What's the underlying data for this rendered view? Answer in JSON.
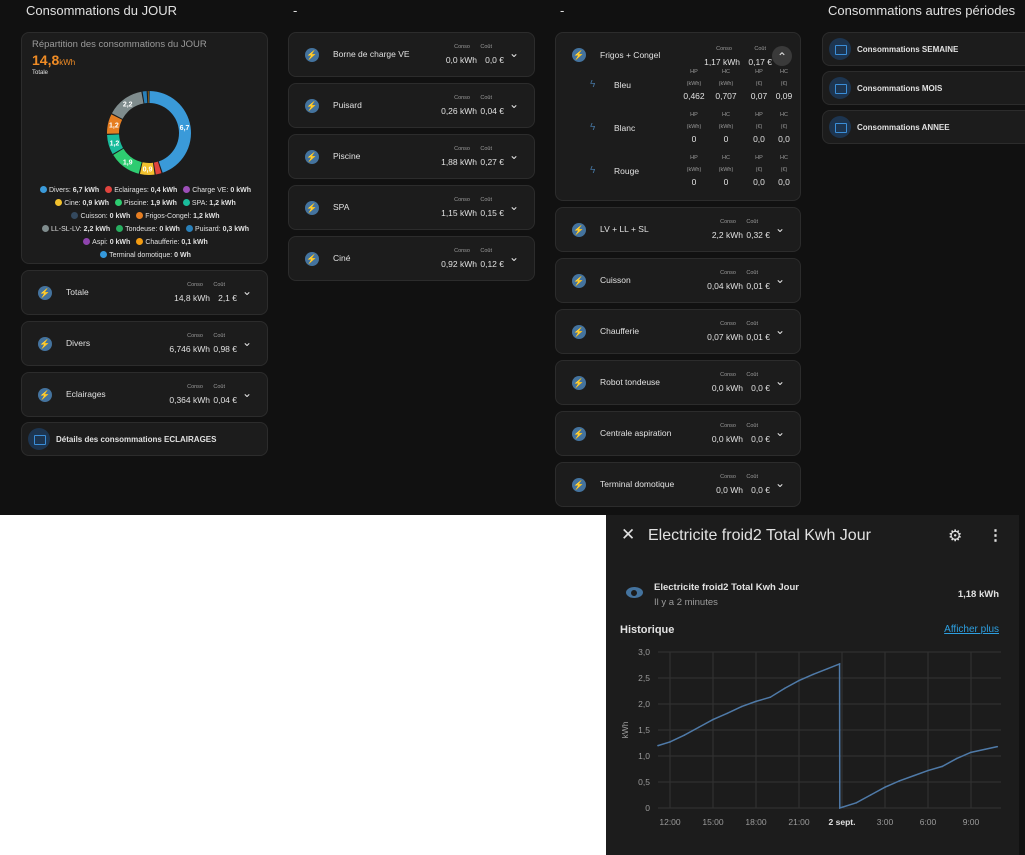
{
  "columns": [
    {
      "title": "Consommations du JOUR"
    },
    {
      "title": "-"
    },
    {
      "title": "-"
    },
    {
      "title": "Consommations autres périodes"
    }
  ],
  "donut_card": {
    "title": "Répartition des consommations du JOUR",
    "total_value": "14,8",
    "total_unit": "kWh",
    "total_label": "Totale"
  },
  "chart_data": [
    {
      "type": "pie",
      "variant": "donut",
      "unit": "kWh",
      "slices": [
        {
          "name": "Divers",
          "value": 6.7,
          "label": "6,7",
          "legend": "6,7 kWh",
          "color": "#3a9ad9"
        },
        {
          "name": "Eclairages",
          "value": 0.4,
          "label": "",
          "legend": "0,4 kWh",
          "color": "#e0443e"
        },
        {
          "name": "Charge VE",
          "value": 0,
          "label": "",
          "legend": "0 kWh",
          "color": "#9c4fb8"
        },
        {
          "name": "Cine",
          "value": 0.9,
          "label": "0,9",
          "legend": "0,9 kWh",
          "color": "#f2c12e"
        },
        {
          "name": "Piscine",
          "value": 1.9,
          "label": "1,9",
          "legend": "1,9 kWh",
          "color": "#2ecc71"
        },
        {
          "name": "SPA",
          "value": 1.2,
          "label": "1,2",
          "legend": "1,2 kWh",
          "color": "#1abc9c"
        },
        {
          "name": "Cuisson",
          "value": 0,
          "label": "",
          "legend": "0 kWh",
          "color": "#34495e"
        },
        {
          "name": "Frigos-Congel",
          "value": 1.2,
          "label": "1,2",
          "legend": "1,2 kWh",
          "color": "#e67e22"
        },
        {
          "name": "LL-SL-LV",
          "value": 2.2,
          "label": "2,2",
          "legend": "2,2 kWh",
          "color": "#7f8c8d"
        },
        {
          "name": "Tondeuse",
          "value": 0,
          "label": "",
          "legend": "0 kWh",
          "color": "#27ae60"
        },
        {
          "name": "Puisard",
          "value": 0.3,
          "label": "",
          "legend": "0,3 kWh",
          "color": "#2980b9"
        },
        {
          "name": "Aspi",
          "value": 0,
          "label": "",
          "legend": "0 kWh",
          "color": "#8e44ad"
        },
        {
          "name": "Chaufferie",
          "value": 0.1,
          "label": "",
          "legend": "0,1 kWh",
          "color": "#f39c12"
        },
        {
          "name": "Terminal domotique",
          "value": 0,
          "label": "",
          "legend": "0 Wh",
          "color": "#3498db"
        }
      ]
    },
    {
      "type": "line",
      "title": "Historique",
      "ylabel": "kWh",
      "ylim": [
        0,
        3
      ],
      "yticks": [
        "0",
        "0,5",
        "1,0",
        "1,5",
        "2,0",
        "2,5",
        "3,0"
      ],
      "xticks": [
        "12:00",
        "15:00",
        "18:00",
        "21:00",
        "2 sept.",
        "3:00",
        "6:00",
        "9:00"
      ],
      "grid": true,
      "color": "#4f7aa8",
      "points": [
        [
          "1 sept. 11:10",
          1.2
        ],
        [
          "1 sept. 12:00",
          1.27
        ],
        [
          "1 sept. 13:00",
          1.4
        ],
        [
          "1 sept. 14:00",
          1.55
        ],
        [
          "1 sept. 15:00",
          1.7
        ],
        [
          "1 sept. 16:00",
          1.82
        ],
        [
          "1 sept. 17:00",
          1.95
        ],
        [
          "1 sept. 18:00",
          2.05
        ],
        [
          "1 sept. 19:00",
          2.13
        ],
        [
          "1 sept. 20:00",
          2.3
        ],
        [
          "1 sept. 21:00",
          2.45
        ],
        [
          "1 sept. 22:00",
          2.57
        ],
        [
          "1 sept. 23:00",
          2.68
        ],
        [
          "1 sept. 23:50",
          2.77
        ],
        [
          "1 sept. 23:51",
          0
        ],
        [
          "2 sept. 01:00",
          0.1
        ],
        [
          "2 sept. 02:00",
          0.25
        ],
        [
          "2 sept. 03:00",
          0.4
        ],
        [
          "2 sept. 04:00",
          0.52
        ],
        [
          "2 sept. 05:00",
          0.62
        ],
        [
          "2 sept. 06:00",
          0.72
        ],
        [
          "2 sept. 07:00",
          0.8
        ],
        [
          "2 sept. 08:00",
          0.95
        ],
        [
          "2 sept. 09:00",
          1.07
        ],
        [
          "2 sept. 10:00",
          1.13
        ],
        [
          "2 sept. 10:50",
          1.18
        ]
      ]
    }
  ],
  "labels": {
    "conso": "Conso",
    "cout": "Coût"
  },
  "col1_cards": [
    {
      "name": "Totale",
      "conso": "14,8 kWh",
      "cout": "2,1 €"
    },
    {
      "name": "Divers",
      "conso": "6,746 kWh",
      "cout": "0,98 €"
    },
    {
      "name": "Eclairages",
      "conso": "0,364 kWh",
      "cout": "0,04 €"
    }
  ],
  "col1_button": "Détails des consommations ECLAIRAGES",
  "col2_cards": [
    {
      "name": "Borne de charge VE",
      "conso": "0,0 kWh",
      "cout": "0,0 €"
    },
    {
      "name": "Puisard",
      "conso": "0,26 kWh",
      "cout": "0,04 €"
    },
    {
      "name": "Piscine",
      "conso": "1,88 kWh",
      "cout": "0,27 €"
    },
    {
      "name": "SPA",
      "conso": "1,15 kWh",
      "cout": "0,15 €"
    },
    {
      "name": "Ciné",
      "conso": "0,92 kWh",
      "cout": "0,12 €"
    }
  ],
  "frigos": {
    "name": "Frigos + Congel",
    "conso": "1,17 kWh",
    "cout": "0,17 €",
    "sub_headers": [
      "HP",
      "HC",
      "HP",
      "HC"
    ],
    "sub_units": [
      "(kWh)",
      "(kWh)",
      "(€)",
      "(€)"
    ],
    "rows": [
      {
        "name": "Bleu",
        "values": [
          "0,462",
          "0,707",
          "0,07",
          "0,09"
        ]
      },
      {
        "name": "Blanc",
        "values": [
          "0",
          "0",
          "0,0",
          "0,0"
        ]
      },
      {
        "name": "Rouge",
        "values": [
          "0",
          "0",
          "0,0",
          "0,0"
        ]
      }
    ]
  },
  "col3_cards": [
    {
      "name": "LV + LL + SL",
      "conso": "2,2 kWh",
      "cout": "0,32 €"
    },
    {
      "name": "Cuisson",
      "conso": "0,04 kWh",
      "cout": "0,01 €"
    },
    {
      "name": "Chaufferie",
      "conso": "0,07 kWh",
      "cout": "0,01 €"
    },
    {
      "name": "Robot tondeuse",
      "conso": "0,0 kWh",
      "cout": "0,0 €"
    },
    {
      "name": "Centrale aspiration",
      "conso": "0,0 kWh",
      "cout": "0,0 €"
    },
    {
      "name": "Terminal domotique",
      "conso": "0,0 Wh",
      "cout": "0,0 €"
    }
  ],
  "col4_buttons": [
    "Consommations SEMAINE",
    "Consommations MOIS",
    "Consommations ANNEE"
  ],
  "dialog": {
    "title": "Electricite froid2 Total Kwh Jour",
    "entity_name": "Electricite froid2 Total Kwh Jour",
    "entity_time": "Il y a 2 minutes",
    "entity_state": "1,18 kWh",
    "history_label": "Historique",
    "more_link": "Afficher plus"
  }
}
